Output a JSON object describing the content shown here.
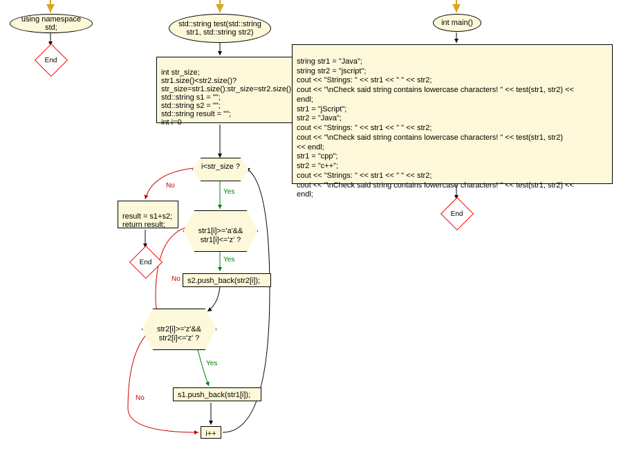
{
  "nodes": {
    "namespace": "using namespace std;",
    "testFunc": "std::string test(std::string\nstr1, std::string str2)",
    "mainFunc": "int main()",
    "initBlock": "int str_size;\nstr1.size()<str2.size()?\nstr_size=str1.size():str_size=str2.size();\nstd::string s1 = \"\";\nstd::string s2 = \"\";\nstd::string result = \"\";\nint i=0",
    "mainBody": "string str1 = \"Java\";\nstring str2 = \"jscript\";\ncout << \"Strings: \" << str1 << \" \" << str2;\ncout << \"\\nCheck said string contains lowercase characters! \" << test(str1, str2) <<\nendl;\nstr1 = \"jScript\";\nstr2 = \"Java\";\ncout << \"Strings: \" << str1 << \" \" << str2;\ncout << \"\\nCheck said string contains  lowercase characters! \" << test(str1, str2)\n<< endl;\nstr1 = \"cpp\";\nstr2 = \"c++\";\ncout << \"Strings: \" << str1 << \" \" << str2;\ncout << \"\\nCheck said string contains lowercase characters! \" << test(str1, str2) <<\nendl;",
    "condLoop": "i<str_size ?",
    "resultBlock": "result = s1+s2;\nreturn result;",
    "condStr1": "str1[i]>='a'&&\nstr1[i]<='z' ?",
    "pushS2": "s2.push_back(str2[i]);",
    "condStr2": "str2[i]>='z'&&\nstr2[i]<='z' ?",
    "pushS1": "s1.push_back(str1[i]);",
    "increment": "i++",
    "end": "End"
  },
  "labels": {
    "yes": "Yes",
    "no": "No"
  }
}
